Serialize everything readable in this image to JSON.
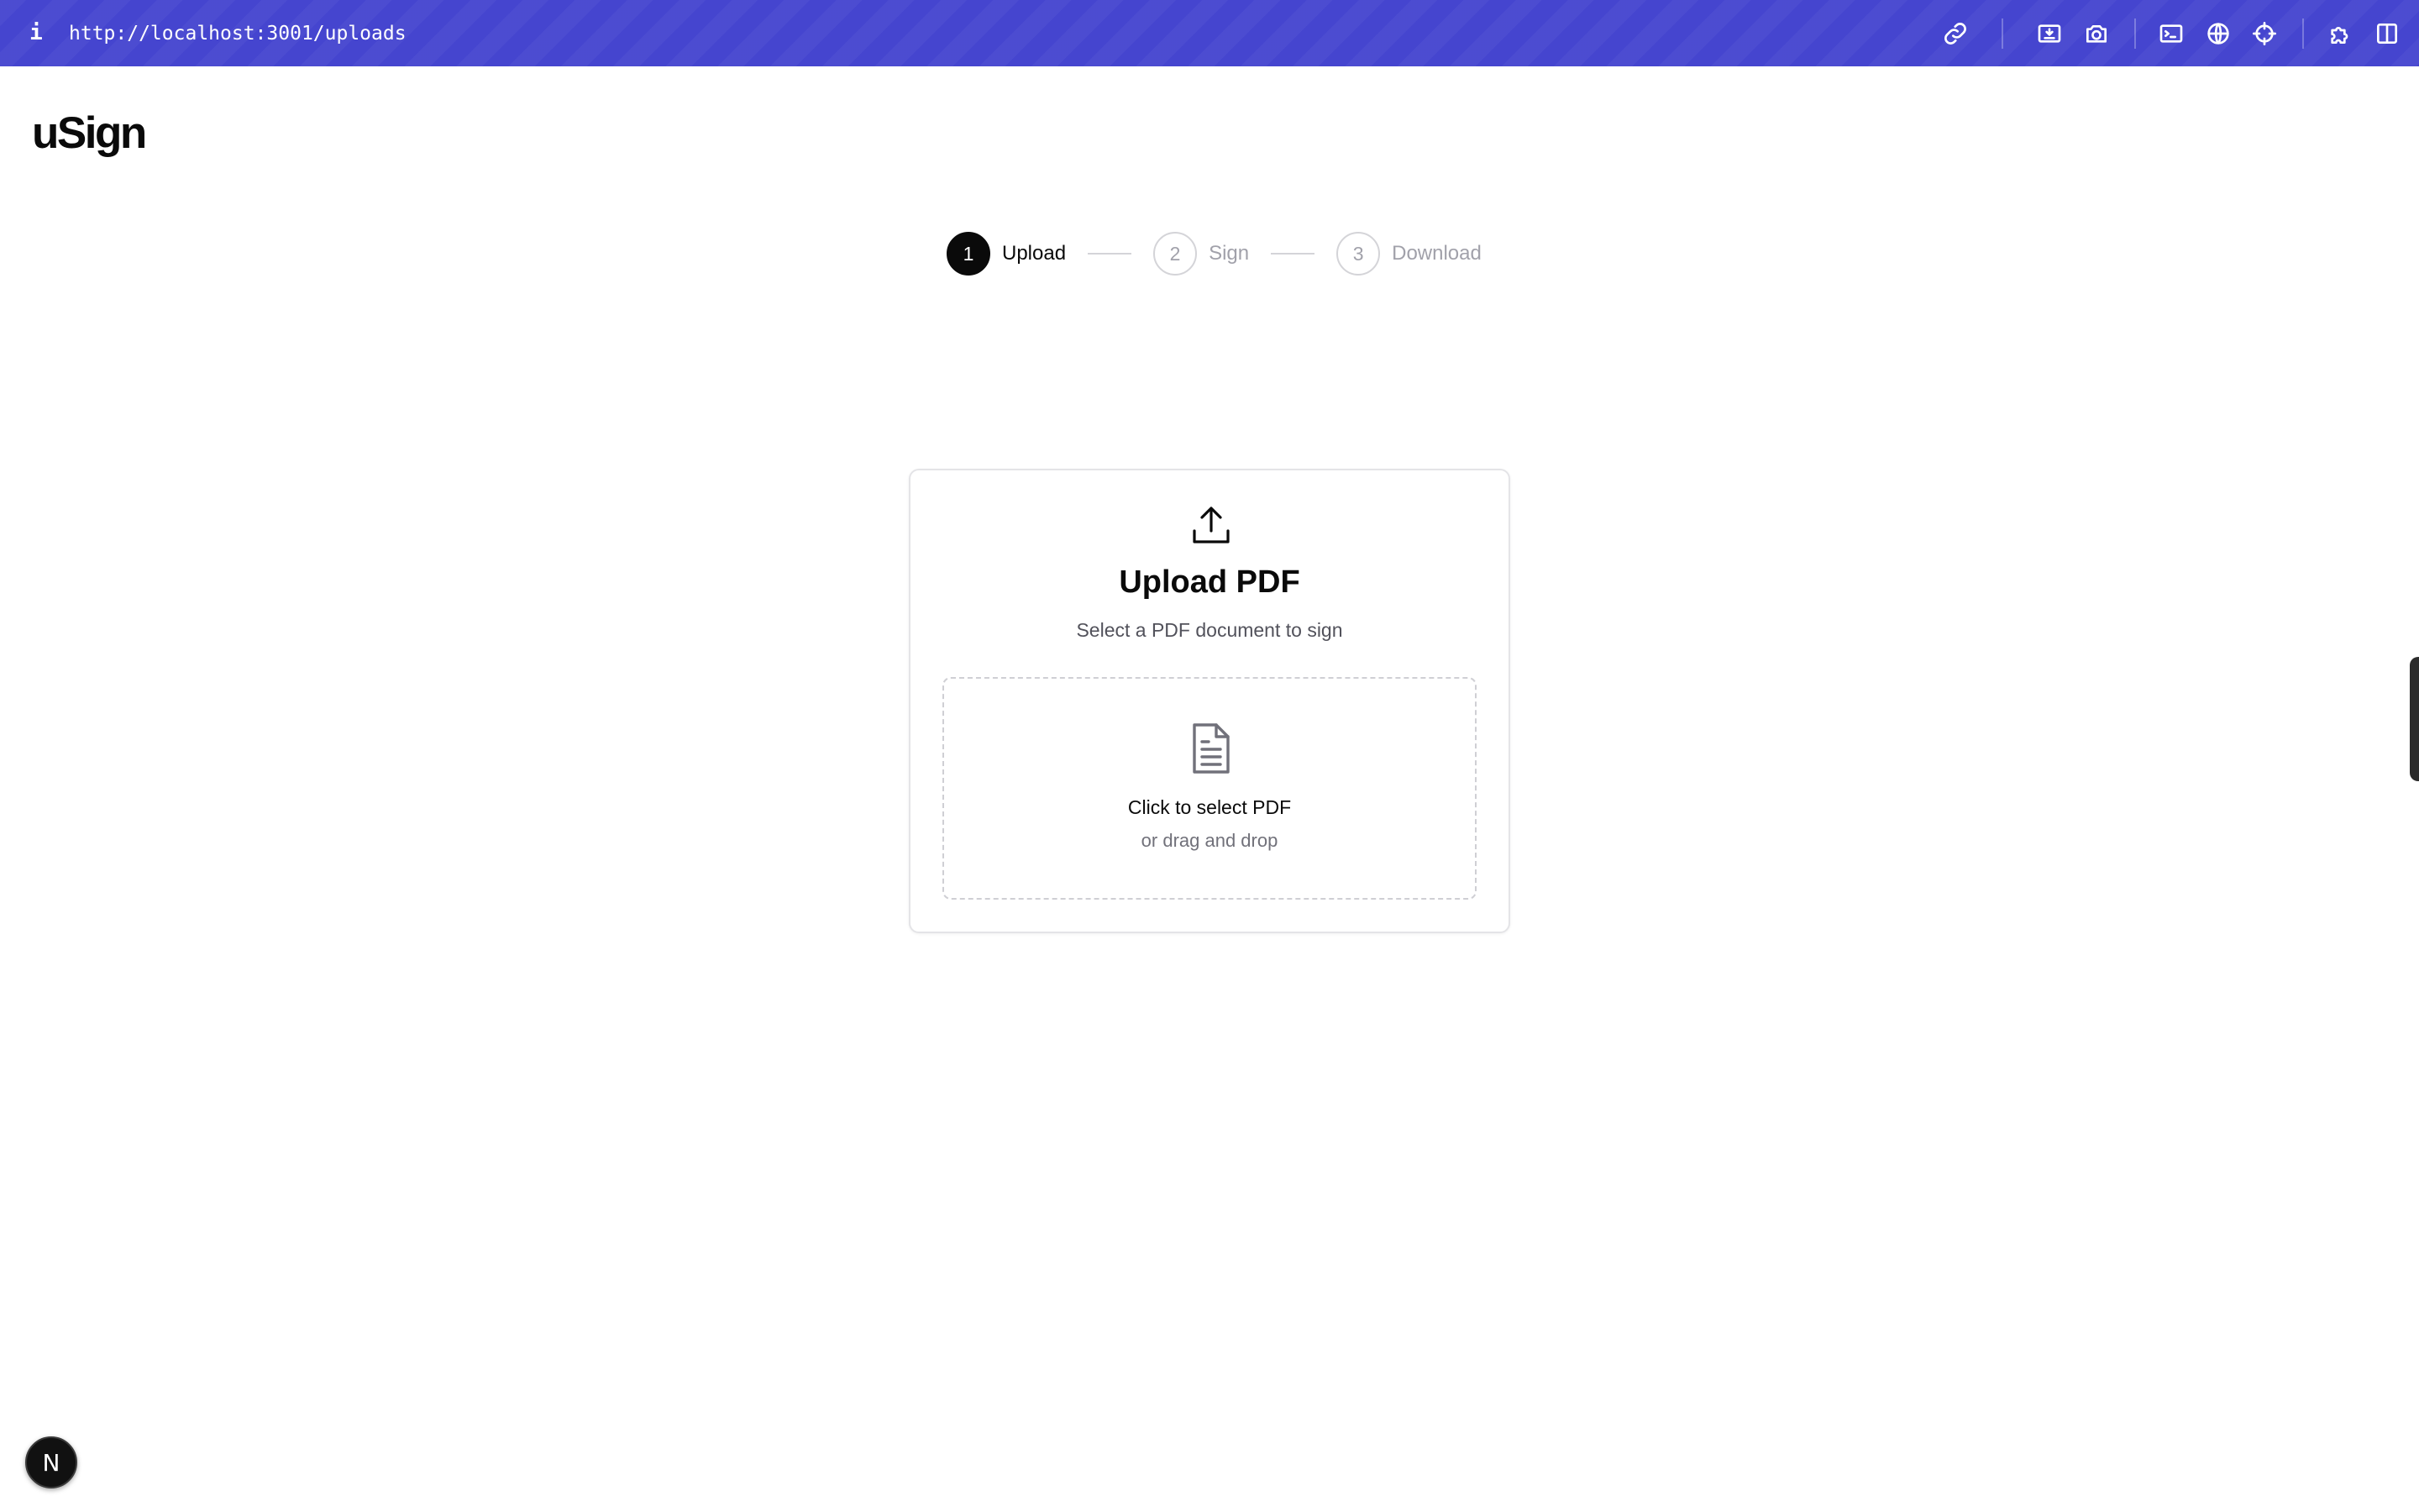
{
  "browser": {
    "info_icon": "i",
    "url": "http://localhost:3001/uploads",
    "toolbar_icons": [
      "link-icon",
      "capture-icon",
      "camera-icon",
      "terminal-icon",
      "globe-icon",
      "crosshair-icon",
      "puzzle-icon",
      "sidebar-icon"
    ],
    "toolbar_color": "#4545cf"
  },
  "app": {
    "logo": "uSign"
  },
  "stepper": {
    "steps": [
      {
        "number": "1",
        "label": "Upload",
        "active": true
      },
      {
        "number": "2",
        "label": "Sign",
        "active": false
      },
      {
        "number": "3",
        "label": "Download",
        "active": false
      }
    ]
  },
  "upload_card": {
    "icon": "upload-icon",
    "title": "Upload PDF",
    "subtitle": "Select a PDF document to sign",
    "dropzone": {
      "icon": "file-text-icon",
      "title": "Click to select PDF",
      "subtitle": "or drag and drop"
    }
  },
  "dev_badge": {
    "letter": "N"
  }
}
